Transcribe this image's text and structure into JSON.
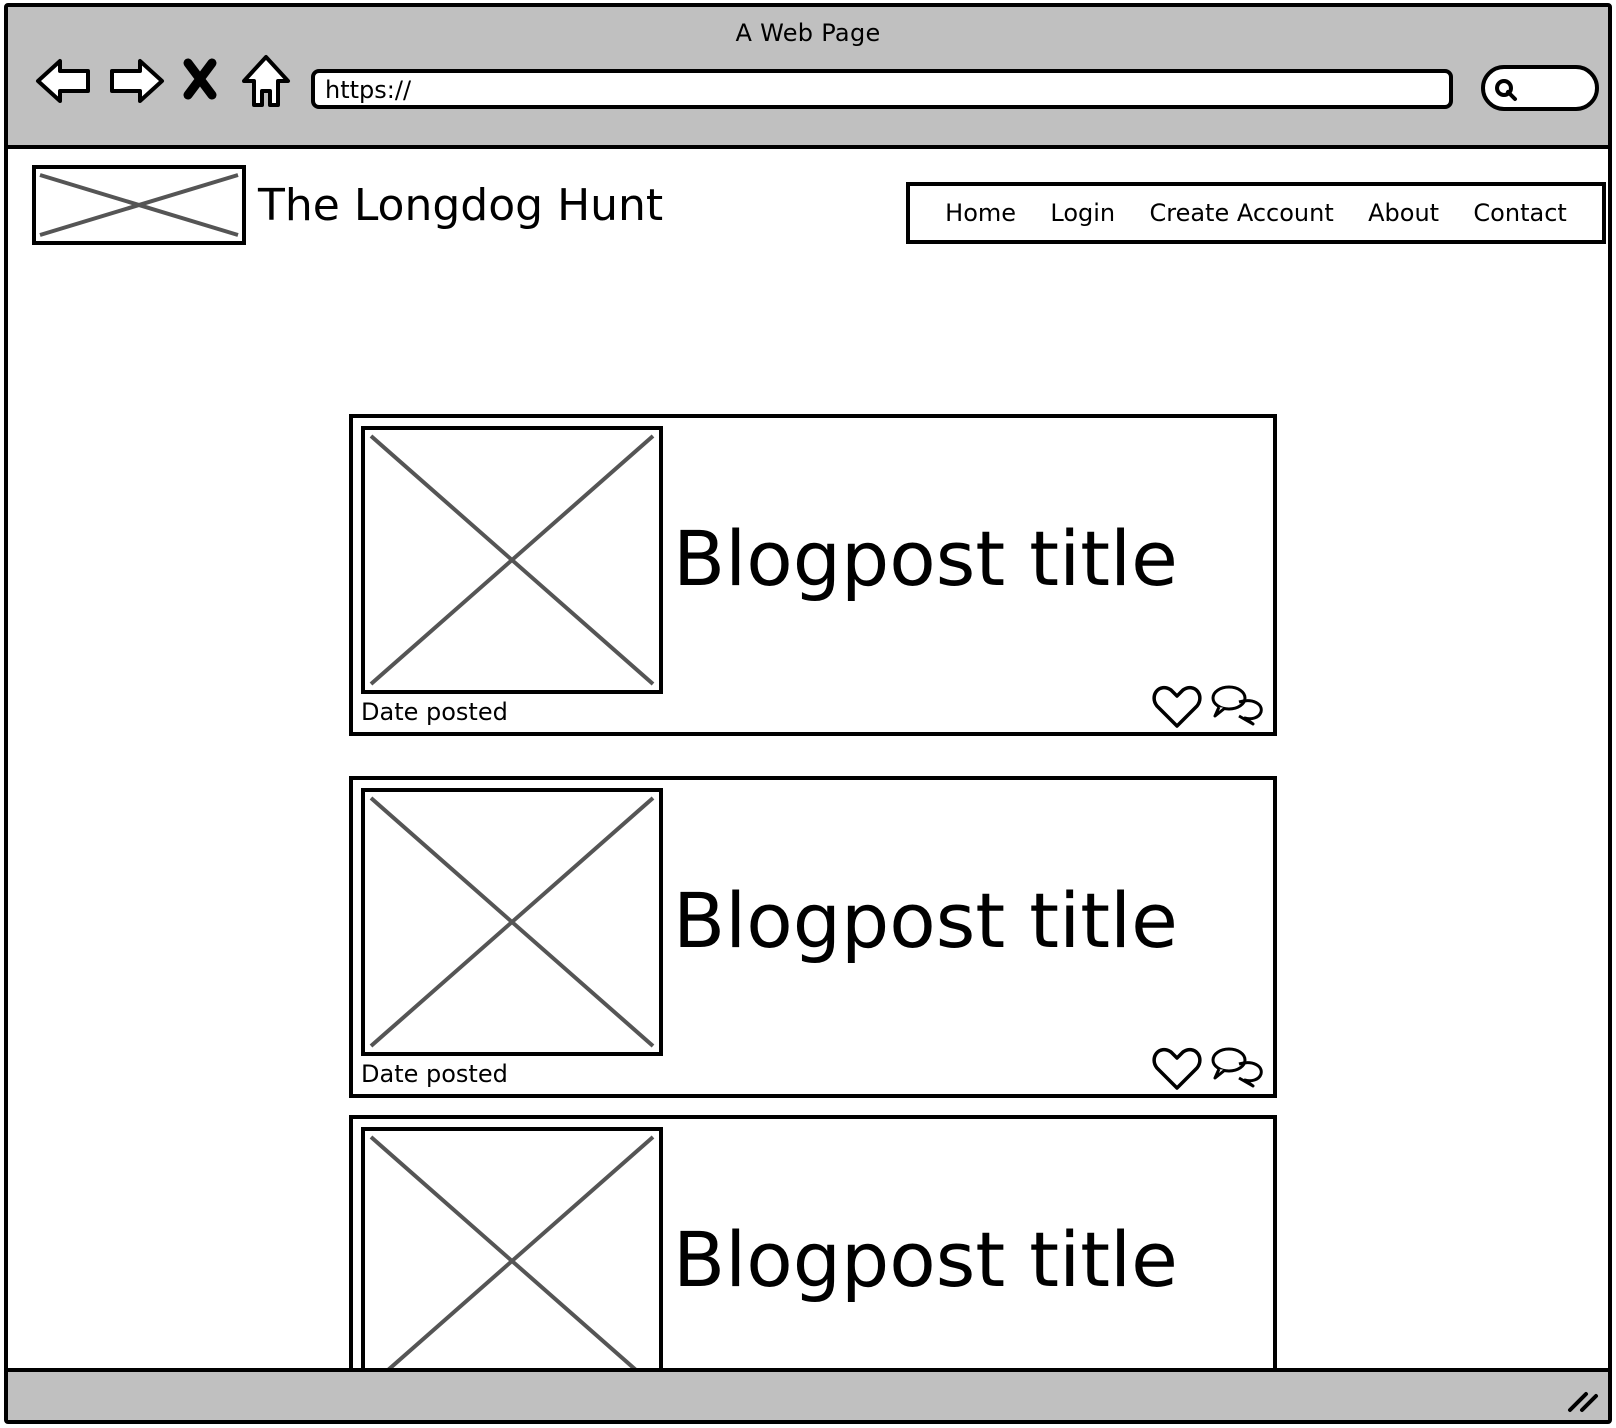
{
  "browser": {
    "window_title": "A Web Page",
    "url": "https://",
    "back_icon": "arrow-left-icon",
    "forward_icon": "arrow-right-icon",
    "stop_icon": "close-icon",
    "home_icon": "home-icon",
    "search_icon": "search-icon"
  },
  "site": {
    "title": "The Longdog Hunt",
    "nav": [
      "Home",
      "Login",
      "Create Account",
      "About",
      "Contact"
    ]
  },
  "posts": [
    {
      "title": "Blogpost title",
      "date_label": "Date posted"
    },
    {
      "title": "Blogpost title",
      "date_label": "Date posted"
    },
    {
      "title": "Blogpost title",
      "date_label": ""
    }
  ],
  "colors": {
    "chrome": "#c0c0c0",
    "placeholder_cross": "#555555",
    "outline": "#000000"
  }
}
